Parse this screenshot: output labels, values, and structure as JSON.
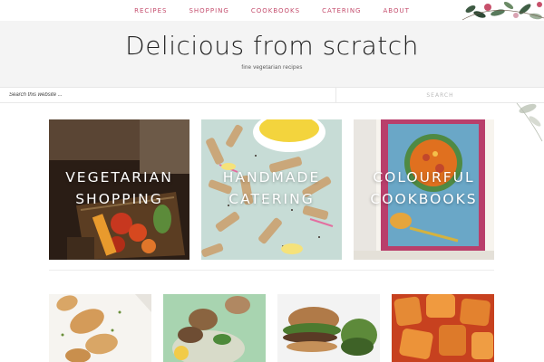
{
  "nav": {
    "items": [
      "RECIPES",
      "SHOPPING",
      "COOKBOOKS",
      "CATERING",
      "ABOUT"
    ]
  },
  "header": {
    "title": "Delicious from scratch",
    "tagline": "fine vegetarian recipes"
  },
  "search": {
    "placeholder": "Search this website ...",
    "button_label": "SEARCH"
  },
  "features": [
    {
      "line1": "VEGETARIAN",
      "line2": "SHOPPING"
    },
    {
      "line1": "HANDMADE",
      "line2": "CATERING"
    },
    {
      "line1": "COLOURFUL",
      "line2": "COOKBOOKS"
    }
  ],
  "colors": {
    "nav_text": "#c44d6d",
    "header_bg": "#f4f4f4",
    "title_text": "#222222"
  },
  "icons": [
    "floral-decoration"
  ]
}
